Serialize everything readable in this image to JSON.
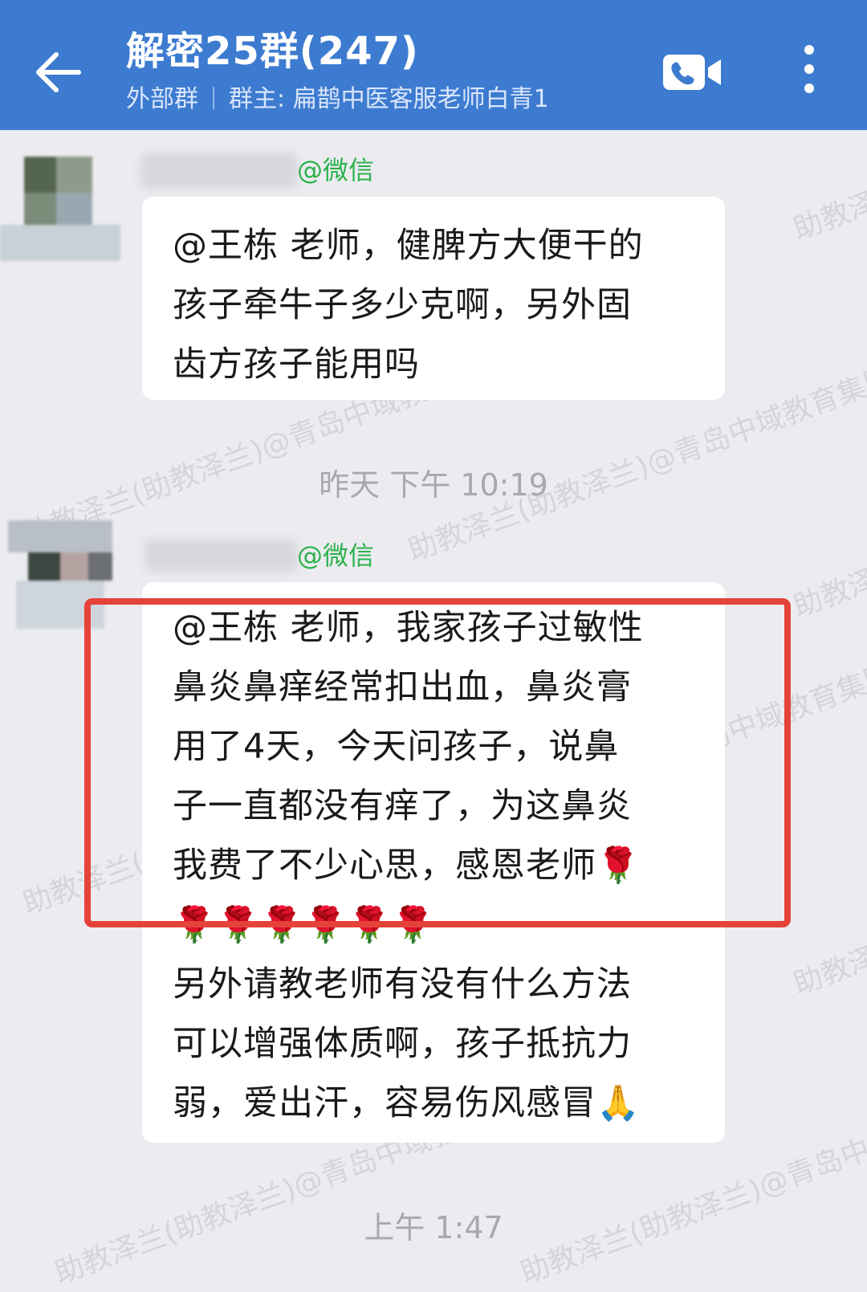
{
  "header": {
    "title": "解密25群(247)",
    "group_type": "外部群",
    "owner": "群主: 扁鹊中医客服老师白青1",
    "back_icon": "back-arrow-icon",
    "call_icon": "voice-video-call-icon",
    "more_icon": "more-vertical-icon"
  },
  "messages": [
    {
      "sender": "@微信",
      "lines": [
        "@王栋 老师，健脾方大便干的",
        "孩子牵牛子多少克啊，另外固",
        "齿方孩子能用吗"
      ]
    },
    {
      "sender": "@微信",
      "lines": [
        "@王栋 老师，我家孩子过敏性",
        "鼻炎鼻痒经常扣出血，鼻炎膏",
        "用了4天，今天问孩子，说鼻",
        "子一直都没有痒了，为这鼻炎",
        "我费了不少心思，感恩老师🌹",
        "🌹🌹🌹🌹🌹🌹",
        "另外请教老师有没有什么方法",
        "可以增强体质啊，孩子抵抗力",
        "弱，爱出汗，容易伤风感冒🙏"
      ]
    }
  ],
  "timestamps": [
    "昨天  下午 10:19",
    "上午 1:47"
  ],
  "watermark": "助教泽兰(助教泽兰)@青岛中域教育集团",
  "colors": {
    "header": "#3d7bd0",
    "background": "#ececf0",
    "sender": "#2bb24c",
    "highlight": "#e5423a"
  }
}
